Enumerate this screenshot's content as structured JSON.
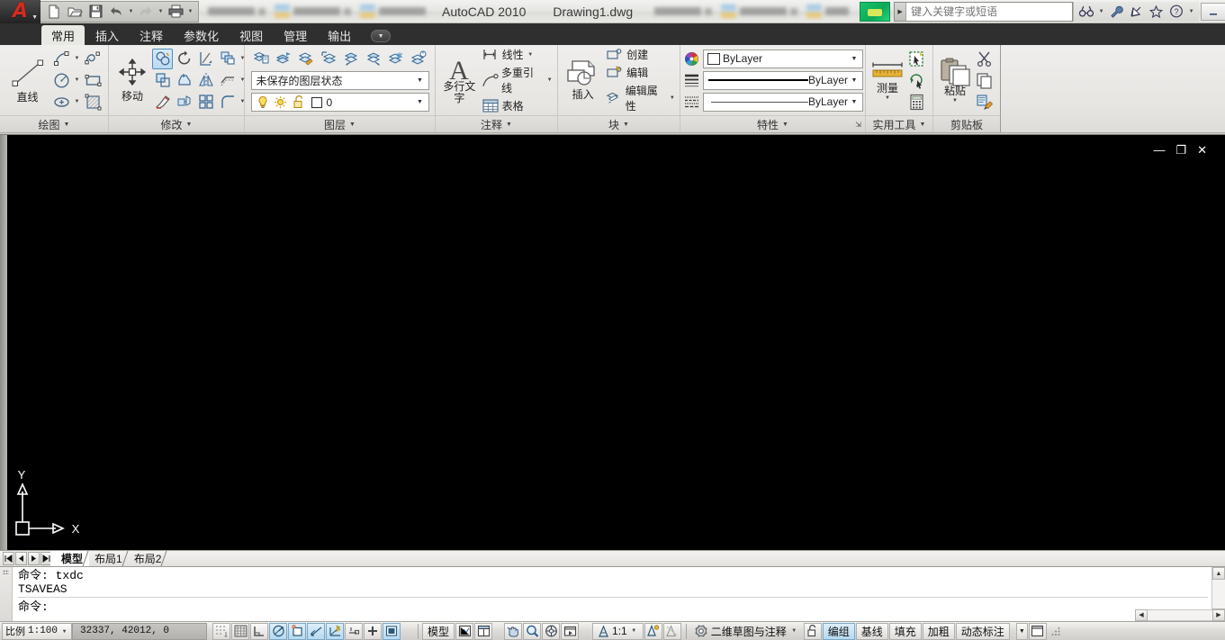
{
  "titlebar": {
    "app_title": "AutoCAD 2010",
    "document_title": "Drawing1.dwg",
    "quick_access": [
      {
        "name": "new-file-button",
        "label": "新建"
      },
      {
        "name": "open-file-button",
        "label": "打开"
      },
      {
        "name": "save-button",
        "label": "保存"
      },
      {
        "name": "undo-button",
        "label": "放弃"
      },
      {
        "name": "redo-button",
        "label": "重做"
      },
      {
        "name": "plot-button",
        "label": "打印"
      }
    ],
    "search_placeholder": "键入关键字或短语",
    "search_value": "",
    "window_buttons": {
      "minimize": "—",
      "restore": "❐",
      "close": "✕"
    }
  },
  "ribbon": {
    "tabs": [
      {
        "label": "常用",
        "active": true
      },
      {
        "label": "插入",
        "active": false
      },
      {
        "label": "注释",
        "active": false
      },
      {
        "label": "参数化",
        "active": false
      },
      {
        "label": "视图",
        "active": false
      },
      {
        "label": "管理",
        "active": false
      },
      {
        "label": "输出",
        "active": false
      }
    ],
    "panels": {
      "draw": {
        "title": "绘图",
        "main_button": "直线",
        "tools": [
          "圆弧",
          "样条曲线",
          "圆",
          "矩形",
          "椭圆",
          "图案填充"
        ]
      },
      "modify": {
        "title": "修改",
        "main_button": "移动",
        "tools": [
          "旋转",
          "修剪",
          "复制",
          "镜像",
          "圆角",
          "缩放",
          "拉伸",
          "阵列",
          "分解",
          "偏移",
          "删除"
        ]
      },
      "layer": {
        "title": "图层",
        "state_value": "未保存的图层状态",
        "current_layer": "0",
        "tools": [
          "图层特性",
          "置为当前",
          "图层匹配",
          "上一个图层",
          "隔离",
          "取消隔离",
          "冻结",
          "关闭"
        ]
      },
      "annotation": {
        "title": "注释",
        "main_button": "多行文字",
        "items": [
          {
            "label": "线性",
            "has_dropdown": true
          },
          {
            "label": "多重引线",
            "has_dropdown": true
          },
          {
            "label": "表格",
            "has_dropdown": false
          }
        ]
      },
      "block": {
        "title": "块",
        "main_button": "插入",
        "items": [
          {
            "label": "创建",
            "has_dropdown": false
          },
          {
            "label": "编辑",
            "has_dropdown": false
          },
          {
            "label": "编辑属性",
            "has_dropdown": true
          }
        ]
      },
      "properties": {
        "title": "特性",
        "rows": [
          {
            "icon": "color-wheel-icon",
            "value": "ByLayer"
          },
          {
            "icon": "lineweight-icon",
            "value": "ByLayer"
          },
          {
            "icon": "linetype-icon",
            "value": "ByLayer"
          }
        ]
      },
      "utilities": {
        "title": "实用工具",
        "main_button": "测量",
        "tools": [
          "快速选择",
          "快速计算器",
          "计算器"
        ]
      },
      "clipboard": {
        "title": "剪贴板",
        "main_button": "粘贴",
        "tools": [
          "剪切",
          "复制",
          "特性匹配"
        ]
      }
    }
  },
  "canvas": {
    "background": "#000000",
    "ucs_x_label": "X",
    "ucs_y_label": "Y",
    "window_buttons": {
      "minimize": "—",
      "restore": "❐",
      "close": "✕"
    }
  },
  "layout_tabs": {
    "nav": [
      "⏮",
      "◀",
      "▶",
      "⏭"
    ],
    "tabs": [
      {
        "label": "模型",
        "active": true
      },
      {
        "label": "布局1",
        "active": false
      },
      {
        "label": "布局2",
        "active": false
      }
    ]
  },
  "command_window": {
    "lines": [
      "命令: txdc",
      "TSAVEAS"
    ],
    "prompt": "命令:"
  },
  "statusbar": {
    "scale_label": "比例",
    "scale_value": "1:100",
    "coordinates": "32337, 42012, 0",
    "toggles": [
      {
        "name": "snap-toggle",
        "label": "捕捉",
        "on": false
      },
      {
        "name": "grid-toggle",
        "label": "栅格",
        "on": false
      },
      {
        "name": "ortho-toggle",
        "label": "正交",
        "on": false
      },
      {
        "name": "polar-toggle",
        "label": "极轴",
        "on": true
      },
      {
        "name": "osnap-toggle",
        "label": "对象捕捉",
        "on": true
      },
      {
        "name": "otrack-toggle",
        "label": "对象追踪",
        "on": true
      },
      {
        "name": "ducs-toggle",
        "label": "动态UCS",
        "on": true
      },
      {
        "name": "dyn-toggle",
        "label": "动态输入",
        "on": false
      },
      {
        "name": "lwt-toggle",
        "label": "线宽",
        "on": false
      },
      {
        "name": "qp-toggle",
        "label": "快捷特性",
        "on": true
      }
    ],
    "model_label": "模型",
    "annotation_scale": "1:1",
    "workspace": "二维草图与注释",
    "right_items": [
      "编组",
      "基线",
      "填充",
      "加粗",
      "动态标注"
    ],
    "right_active": [
      "编组"
    ]
  }
}
